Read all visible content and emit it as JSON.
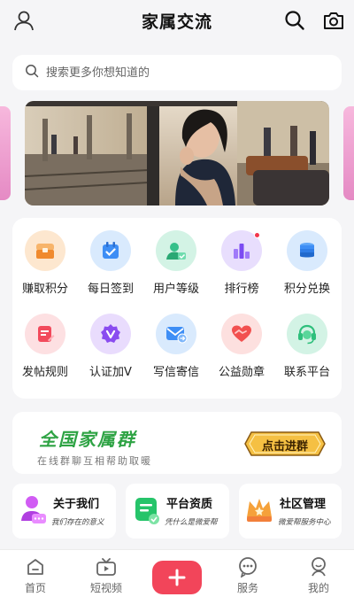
{
  "header": {
    "title": "家属交流",
    "icons": [
      "user-icon",
      "search-icon",
      "camera-icon"
    ]
  },
  "search": {
    "placeholder": "搜索更多你想知道的"
  },
  "menu": {
    "row1": [
      {
        "label": "赚取积分",
        "icon": "treasure-chest-icon",
        "color": "#f6a44a"
      },
      {
        "label": "每日签到",
        "icon": "calendar-check-icon",
        "color": "#3e8ef5"
      },
      {
        "label": "用户等级",
        "icon": "user-level-icon",
        "color": "#36c08a"
      },
      {
        "label": "排行榜",
        "icon": "bar-chart-icon",
        "color": "#8a5cf6",
        "badge": true
      },
      {
        "label": "积分兑换",
        "icon": "coins-icon",
        "color": "#3e8ef5"
      }
    ],
    "row2": [
      {
        "label": "发帖规则",
        "icon": "document-edit-icon",
        "color": "#f24a5c"
      },
      {
        "label": "认证加V",
        "icon": "verified-v-icon",
        "color": "#8a4cf0"
      },
      {
        "label": "写信寄信",
        "icon": "mail-send-icon",
        "color": "#3e8ef5"
      },
      {
        "label": "公益勋章",
        "icon": "heart-hands-icon",
        "color": "#f2504f"
      },
      {
        "label": "联系平台",
        "icon": "headset-icon",
        "color": "#2fbf7c"
      }
    ]
  },
  "group": {
    "title": "全国家属群",
    "subtitle": "在线群聊互相帮助取暖",
    "button": "点击进群"
  },
  "features": [
    {
      "title": "关于我们",
      "subtitle": "我们存在的意义",
      "icon": "person-chat-icon",
      "color": "#c24ff0"
    },
    {
      "title": "平台资质",
      "subtitle": "凭什么是微爱帮",
      "icon": "certificate-icon",
      "color": "#26c46a"
    },
    {
      "title": "社区管理",
      "subtitle": "微爱帮服务中心",
      "icon": "crown-icon",
      "color": "#f5a13a"
    }
  ],
  "tabs": [
    {
      "label": "首页",
      "icon": "home-icon"
    },
    {
      "label": "短视频",
      "icon": "tv-icon"
    },
    {
      "label": "服务",
      "icon": "chat-bubble-icon"
    },
    {
      "label": "我的",
      "icon": "profile-icon"
    }
  ],
  "colors": {
    "accent": "#f2455a",
    "green": "#2ea344",
    "gold": "#f5c043"
  }
}
